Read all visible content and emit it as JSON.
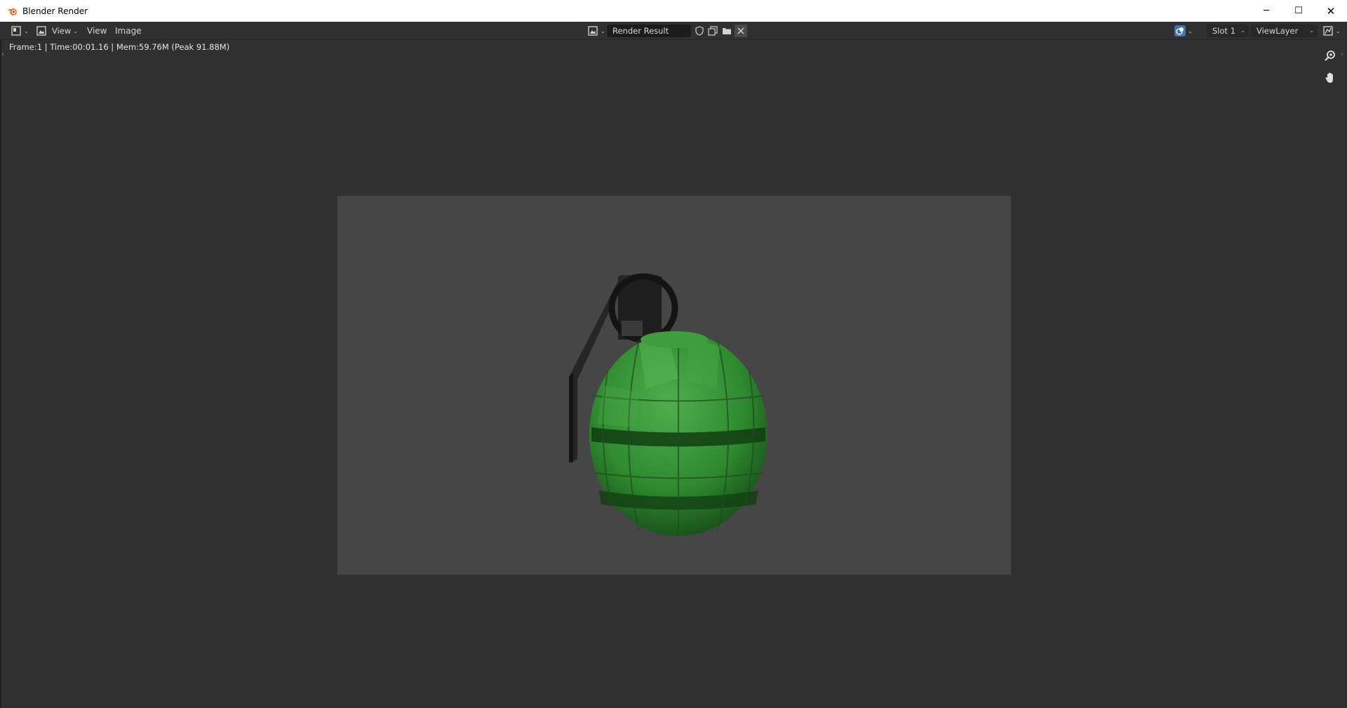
{
  "window": {
    "title": "Blender Render",
    "controls": {
      "minimize": "─",
      "maximize": "☐",
      "close": "✕"
    }
  },
  "header": {
    "editor_type_icon": "image-editor-icon",
    "mode_icon": "image-icon",
    "menu": {
      "view_dropdown": "View",
      "view": "View",
      "image": "Image"
    },
    "image_browse_icon": "image-browse-icon",
    "image_name": "Render Result",
    "slot": "Slot 1",
    "view_layer": "ViewLayer",
    "chevron": "⌄"
  },
  "status": {
    "frame_info": "Frame:1 | Time:00:01.16 | Mem:59.76M (Peak 91.88M)"
  },
  "viewport_tools": {
    "zoom_icon": "zoom-icon",
    "pan_icon": "hand-pan-icon"
  },
  "colors": {
    "background": "#303030",
    "render_background": "#464646",
    "grenade_green": "#3b9a3b",
    "grenade_dark_green": "#1f5a1f",
    "metal": "#1c1c1c"
  }
}
